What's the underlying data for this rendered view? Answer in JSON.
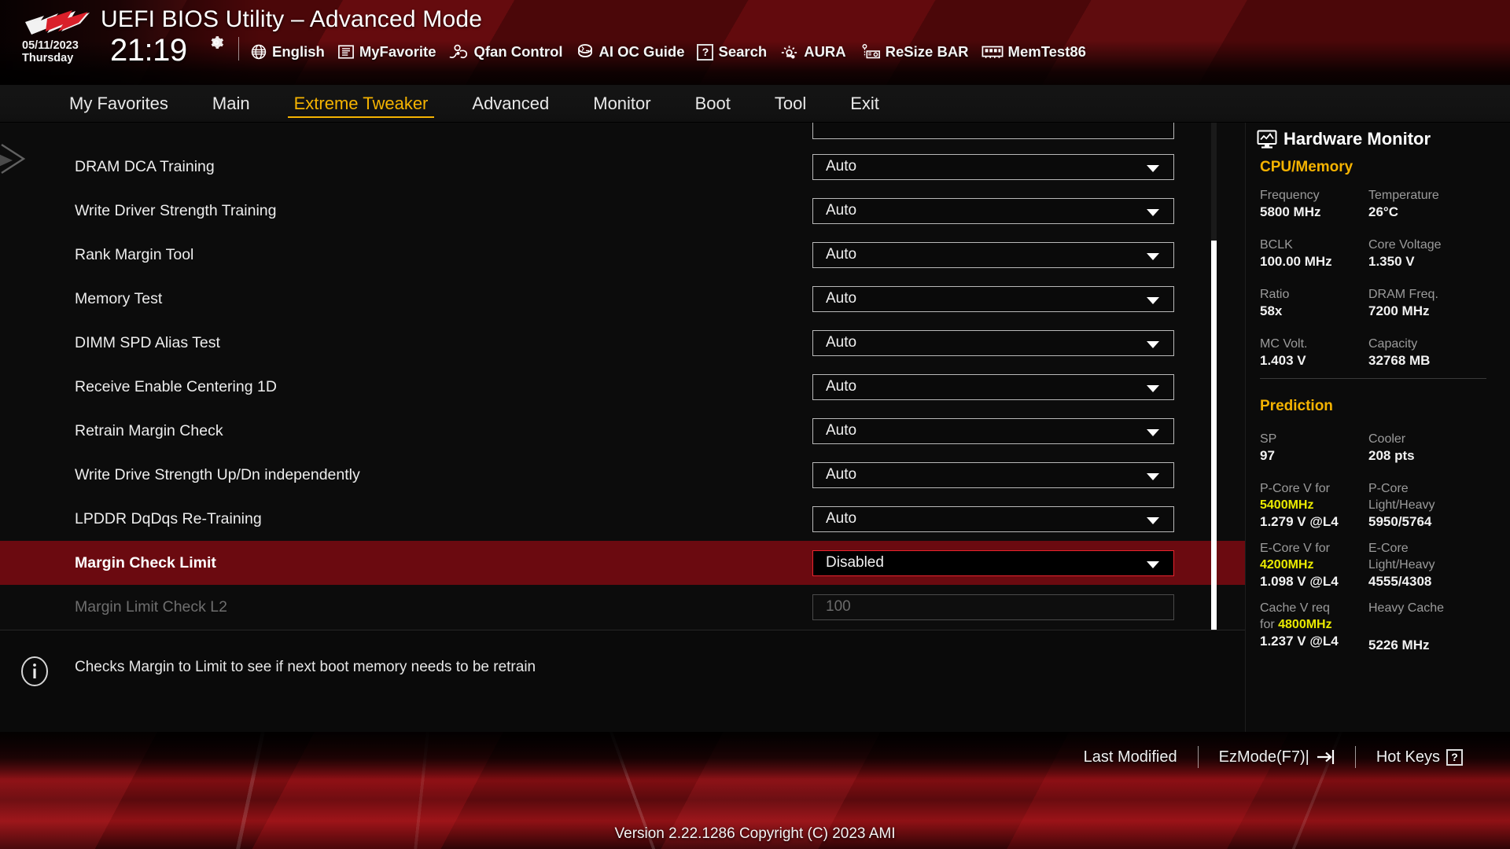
{
  "header": {
    "title": "UEFI BIOS Utility – Advanced Mode",
    "date": "05/11/2023",
    "weekday": "Thursday",
    "time": "21:19",
    "gear_icon": "gear-icon",
    "tools": [
      {
        "icon": "globe-icon",
        "label": "English"
      },
      {
        "icon": "myfavorite-icon",
        "label": "MyFavorite"
      },
      {
        "icon": "qfan-icon",
        "label": "Qfan Control"
      },
      {
        "icon": "aioc-icon",
        "label": "AI OC Guide"
      },
      {
        "icon": "question-icon",
        "label": "Search"
      },
      {
        "icon": "aura-icon",
        "label": "AURA"
      },
      {
        "icon": "resizebar-icon",
        "label": "ReSize BAR"
      },
      {
        "icon": "memtest-icon",
        "label": "MemTest86"
      }
    ]
  },
  "nav": {
    "active": "Extreme Tweaker",
    "items": [
      {
        "label": "My Favorites"
      },
      {
        "label": "Main"
      },
      {
        "label": "Extreme Tweaker"
      },
      {
        "label": "Advanced"
      },
      {
        "label": "Monitor"
      },
      {
        "label": "Boot"
      },
      {
        "label": "Tool"
      },
      {
        "label": "Exit"
      }
    ]
  },
  "settings": {
    "rows": [
      {
        "label": "",
        "value": "",
        "state": "clipped"
      },
      {
        "label": "DRAM DCA Training",
        "value": "Auto",
        "state": "normal"
      },
      {
        "label": "Write Driver Strength Training",
        "value": "Auto",
        "state": "normal"
      },
      {
        "label": "Rank Margin Tool",
        "value": "Auto",
        "state": "normal"
      },
      {
        "label": "Memory Test",
        "value": "Auto",
        "state": "normal"
      },
      {
        "label": "DIMM SPD Alias Test",
        "value": "Auto",
        "state": "normal"
      },
      {
        "label": "Receive Enable Centering 1D",
        "value": "Auto",
        "state": "normal"
      },
      {
        "label": "Retrain Margin Check",
        "value": "Auto",
        "state": "normal"
      },
      {
        "label": "Write Drive Strength Up/Dn independently",
        "value": "Auto",
        "state": "normal"
      },
      {
        "label": "LPDDR DqDqs Re-Training",
        "value": "Auto",
        "state": "normal"
      },
      {
        "label": "Margin Check Limit",
        "value": "Disabled",
        "state": "selected"
      },
      {
        "label": "Margin Limit Check L2",
        "value": "100",
        "state": "dim"
      }
    ]
  },
  "help": {
    "icon": "info-icon",
    "text": "Checks Margin to Limit to see if next boot memory needs to be retrain"
  },
  "hardware_monitor": {
    "icon": "monitor-icon",
    "title": "Hardware Monitor",
    "sections": [
      {
        "name": "CPU/Memory",
        "pairs": [
          {
            "key": "Frequency",
            "value": "5800 MHz",
            "key2": "Temperature",
            "value2": "26°C"
          },
          {
            "key": "BCLK",
            "value": "100.00 MHz",
            "key2": "Core Voltage",
            "value2": "1.350 V"
          },
          {
            "key": "Ratio",
            "value": "58x",
            "key2": "DRAM Freq.",
            "value2": "7200 MHz"
          },
          {
            "key": "MC Volt.",
            "value": "1.403 V",
            "key2": "Capacity",
            "value2": "32768 MB"
          }
        ]
      },
      {
        "name": "Prediction",
        "pairs": [
          {
            "key": "SP",
            "value": "97",
            "key2": "Cooler",
            "value2": "208 pts"
          }
        ],
        "predictions": [
          {
            "key_line1": "P-Core V for",
            "key_hl": "5400MHz",
            "value": "1.279 V @L4",
            "key2_line1": "P-Core",
            "key2_line2": "Light/Heavy",
            "value2": "5950/5764"
          },
          {
            "key_line1": "E-Core V for",
            "key_hl": "4200MHz",
            "value": "1.098 V @L4",
            "key2_line1": "E-Core",
            "key2_line2": "Light/Heavy",
            "value2": "4555/4308"
          },
          {
            "key_line1": "Cache V req",
            "key_line1b": "for",
            "key_hl": "4800MHz",
            "value": "1.237 V @L4",
            "key2_line1": "Heavy Cache",
            "key2_line2": "",
            "value2": "5226 MHz"
          }
        ]
      }
    ]
  },
  "footer": {
    "actions": [
      {
        "label": "Last Modified",
        "icon": ""
      },
      {
        "label": "EzMode(F7)|",
        "icon": "ezmode-icon"
      },
      {
        "label": "Hot Keys",
        "icon": "question-icon"
      }
    ],
    "version": "Version 2.22.1286 Copyright (C) 2023 AMI"
  },
  "colors": {
    "accent_gold": "#f5b301",
    "selected_row": "#6b0a10",
    "selected_border": "#e8242e",
    "highlight_yellow": "#eaea00",
    "brand_red": "#8e0f12"
  }
}
